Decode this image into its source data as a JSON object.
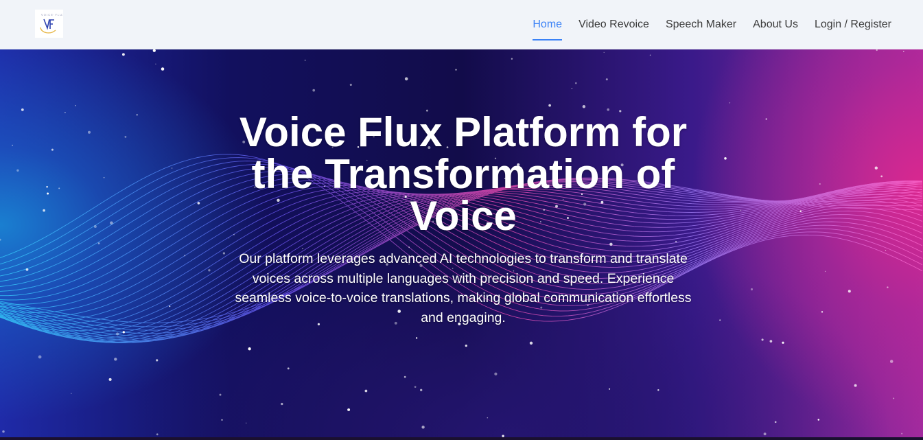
{
  "header": {
    "logo_icon": "voice-flux-logo",
    "nav": [
      {
        "label": "Home",
        "active": true
      },
      {
        "label": "Video Revoice",
        "active": false
      },
      {
        "label": "Speech Maker",
        "active": false
      },
      {
        "label": "About Us",
        "active": false
      },
      {
        "label": "Login / Register",
        "active": false
      }
    ],
    "active_color": "#3b82f6"
  },
  "hero": {
    "title": "Voice Flux Platform for the Transformation of Voice",
    "description": "Our platform leverages advanced AI technologies to transform and translate voices across multiple languages with precision and speed. Experience seamless voice-to-voice translations, making global communication effortless and engaging.",
    "background_icon": "sound-wave-background",
    "colors": {
      "left": "#1a7fd0",
      "center": "#120c4a",
      "right": "#d9288f"
    }
  }
}
